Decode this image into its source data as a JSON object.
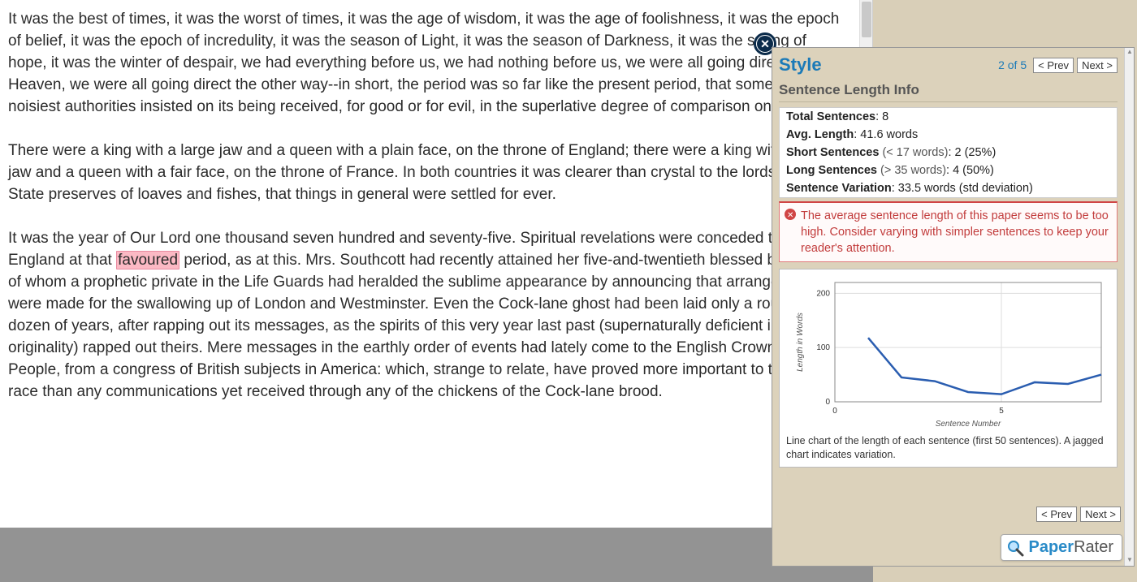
{
  "document": {
    "para1": "It was the best of times, it was the worst of times, it was the age of wisdom, it was the age of foolishness, it was the epoch of belief, it was the epoch of incredulity, it was the season of Light, it was the season of Darkness, it was the spring of hope, it was the winter of despair, we had everything before us, we had nothing before us, we were all going direct to Heaven, we were all going direct the other way--in short, the period was so far like the present period, that some of its noisiest authorities insisted on its being received, for good or for evil, in the superlative degree of comparison only.",
    "para2": "There were a king with a large jaw and a queen with a plain face, on the throne of England; there were a king with a large jaw and a queen with a fair face, on the throne of France. In both countries it was clearer than crystal to the lords of the State preserves of loaves and fishes, that things in general were settled for ever.",
    "para3_a": "It was the year of Our Lord one thousand seven hundred and seventy-five. Spiritual revelations were conceded to England at that ",
    "para3_hl": "favoured",
    "para3_b": " period, as at this. Mrs. Southcott had recently attained her five-and-twentieth blessed birthday, of whom a prophetic private in the Life Guards had heralded the sublime appearance by announcing that arrangements were made for the swallowing up of London and Westminster. Even the Cock-lane ghost had been laid only a round dozen of years, after rapping out its messages, as the spirits of this very year last past (supernaturally deficient in originality) rapped out theirs. Mere messages in the earthly order of events had lately come to the English Crown and People, from a congress of British subjects in America: which, strange to relate, have proved more important to the human race than any communications yet received through any of the chickens of the Cock-lane brood."
  },
  "panel": {
    "title": "Style",
    "counter": "2 of 5",
    "prev": "< Prev",
    "next": "Next >",
    "subhead": "Sentence Length Info",
    "stats": {
      "total_label": "Total Sentences",
      "total_value": ": 8",
      "avg_label": "Avg. Length",
      "avg_value": ": 41.6 words",
      "short_label": "Short Sentences",
      "short_sub": " (< 17 words)",
      "short_value": ": 2 (25%)",
      "long_label": "Long Sentences",
      "long_sub": " (> 35 words)",
      "long_value": ": 4 (50%)",
      "var_label": "Sentence Variation",
      "var_value": ": 33.5 words (std deviation)"
    },
    "warning": "The average sentence length of this paper seems to be too high. Consider varying with simpler sentences to keep your reader's attention.",
    "chart_caption": "Line chart of the length of each sentence (first 50 sentences). A jagged chart indicates variation.",
    "brand_part1": "Paper",
    "brand_part2": "Rater"
  },
  "chart_data": {
    "type": "line",
    "title": "",
    "xlabel": "Sentence Number",
    "ylabel": "Length in Words",
    "x": [
      1,
      2,
      3,
      4,
      5,
      6,
      7,
      8
    ],
    "values": [
      118,
      45,
      38,
      18,
      14,
      36,
      33,
      50
    ],
    "xlim": [
      0,
      8
    ],
    "ylim": [
      0,
      220
    ],
    "xticks": [
      0,
      5
    ],
    "yticks": [
      0,
      100,
      200
    ]
  }
}
